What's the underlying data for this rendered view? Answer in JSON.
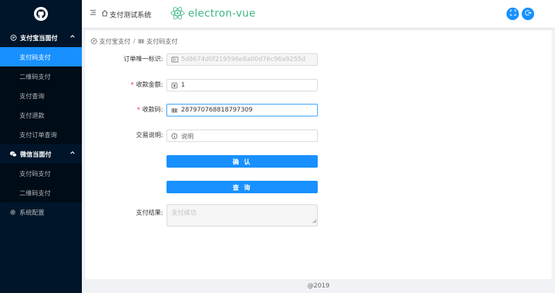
{
  "sidebar": {
    "groups": [
      {
        "label": "支付宝当面付",
        "icon": "alipay-icon",
        "expanded": true,
        "items": [
          {
            "label": "支付码支付",
            "active": true
          },
          {
            "label": "二维码支付",
            "active": false
          },
          {
            "label": "支付查询",
            "active": false
          },
          {
            "label": "支付退款",
            "active": false
          },
          {
            "label": "支付订单查询",
            "active": false
          }
        ]
      },
      {
        "label": "微信当面付",
        "icon": "wechat-icon",
        "expanded": true,
        "items": [
          {
            "label": "支付码支付",
            "active": false
          },
          {
            "label": "二维码支付",
            "active": false
          }
        ]
      }
    ],
    "settings": {
      "label": "系统配置",
      "icon": "gear-icon"
    }
  },
  "header": {
    "title": "支付测试系统",
    "brand": "electron-vue",
    "actions": [
      "fullscreen-icon",
      "logout-icon"
    ]
  },
  "breadcrumb": [
    "支付宝支付",
    "支付码支付"
  ],
  "form": {
    "order_id": {
      "label": "订单唯一标识:",
      "value": "5d8674d0f219596e8a00d76c96a9255d",
      "disabled": true
    },
    "amount": {
      "label": "收款金额:",
      "value": "1",
      "required": true
    },
    "auth_code": {
      "label": "收款码:",
      "value": "287970768818797309",
      "required": true
    },
    "description": {
      "label": "交易说明:",
      "placeholder": "说明"
    },
    "confirm_button": "确 认",
    "query_button": "查 询",
    "result": {
      "label": "支付结果:",
      "value": "支付成功"
    }
  },
  "footer": "@2019",
  "colors": {
    "sidebar": "#001529",
    "primary": "#1890ff",
    "brand": "#41b883",
    "required": "#f5222d"
  }
}
